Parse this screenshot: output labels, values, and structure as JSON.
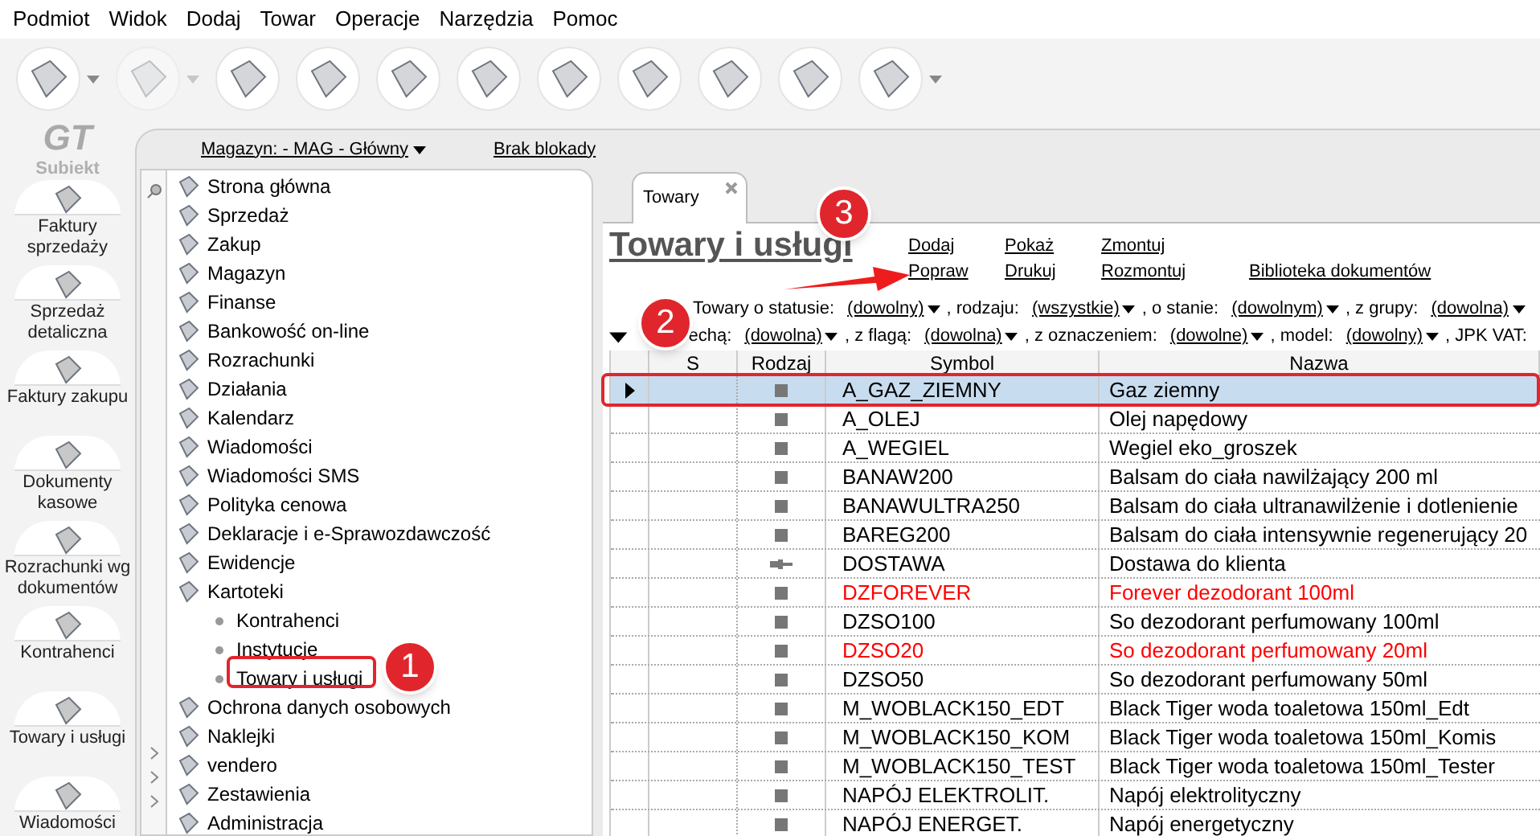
{
  "menu": [
    "Podmiot",
    "Widok",
    "Dodaj",
    "Towar",
    "Operacje",
    "Narzędzia",
    "Pomoc"
  ],
  "toolbar": [
    {
      "dropdown": true,
      "disabled": false
    },
    {
      "dropdown": true,
      "disabled": true
    },
    {
      "dropdown": false,
      "disabled": false
    },
    {
      "dropdown": false,
      "disabled": false
    },
    {
      "dropdown": false,
      "disabled": false
    },
    {
      "dropdown": false,
      "disabled": false
    },
    {
      "dropdown": false,
      "disabled": false
    },
    {
      "dropdown": false,
      "disabled": false
    },
    {
      "dropdown": false,
      "disabled": false
    },
    {
      "dropdown": false,
      "disabled": false
    },
    {
      "dropdown": true,
      "disabled": false
    }
  ],
  "logo": {
    "mark": "GT",
    "name": "Subiekt"
  },
  "rail": [
    "Faktury sprzedaży",
    "Sprzedaż detaliczna",
    "Faktury zakupu",
    "Dokumenty kasowe",
    "Rozrachunki wg dokumentów",
    "Kontrahenci",
    "Towary i usługi",
    "Wiadomości"
  ],
  "topbar": {
    "warehouse": "Magazyn: - MAG - Główny",
    "lock": "Brak blokady"
  },
  "nav": [
    {
      "label": "Strona główna"
    },
    {
      "label": "Sprzedaż"
    },
    {
      "label": "Zakup"
    },
    {
      "label": "Magazyn"
    },
    {
      "label": "Finanse"
    },
    {
      "label": "Bankowość on-line"
    },
    {
      "label": "Rozrachunki"
    },
    {
      "label": "Działania"
    },
    {
      "label": "Kalendarz"
    },
    {
      "label": "Wiadomości"
    },
    {
      "label": "Wiadomości SMS"
    },
    {
      "label": "Polityka cenowa"
    },
    {
      "label": "Deklaracje i e-Sprawozdawczość"
    },
    {
      "label": "Ewidencje"
    },
    {
      "label": "Kartoteki",
      "children": [
        {
          "label": "Kontrahenci"
        },
        {
          "label": "Instytucje"
        },
        {
          "label": "Towary i usługi"
        }
      ]
    },
    {
      "label": "Ochrona danych osobowych"
    },
    {
      "label": "Naklejki"
    },
    {
      "label": "vendero"
    },
    {
      "label": "Zestawienia"
    },
    {
      "label": "Administracja"
    }
  ],
  "tab": {
    "label": "Towary",
    "selected": true
  },
  "heading": "Towary i usługi",
  "actions": [
    [
      "Dodaj",
      "Popraw"
    ],
    [
      "Pokaż",
      "Drukuj"
    ],
    [
      "Zmontuj",
      "Rozmontuj"
    ],
    [
      "Biblioteka dokumentów"
    ]
  ],
  "filters": [
    [
      {
        "label": "Towary o statusie:",
        "value": "(dowolny)"
      },
      {
        "label": ", rodzaju:",
        "value": "(wszystkie)"
      },
      {
        "label": ", o stanie:",
        "value": "(dowolnym)"
      },
      {
        "label": ", z grupy:",
        "value": "(dowolna)"
      }
    ],
    [
      {
        "label": "echą:",
        "value": "(dowolna)"
      },
      {
        "label": ", z flagą:",
        "value": "(dowolna)"
      },
      {
        "label": ", z oznaczeniem:",
        "value": "(dowolne)"
      },
      {
        "label": ", model:",
        "value": "(dowolny)"
      },
      {
        "label": ", JPK VAT:"
      }
    ]
  ],
  "table": {
    "columns": [
      "S",
      "Rodzaj",
      "Symbol",
      "Nazwa"
    ],
    "rows": [
      {
        "kind": "goods",
        "symbol": "A_GAZ_ZIEMNY",
        "name": "Gaz ziemny",
        "selected": true,
        "color": "#000000"
      },
      {
        "kind": "goods",
        "symbol": "A_OLEJ",
        "name": "Olej napędowy",
        "selected": false,
        "color": "#000000"
      },
      {
        "kind": "goods",
        "symbol": "A_WEGIEL",
        "name": "Wegiel eko_groszek",
        "selected": false,
        "color": "#000000"
      },
      {
        "kind": "goods",
        "symbol": "BANAW200",
        "name": "Balsam do ciała nawilżający 200 ml",
        "selected": false,
        "color": "#000000"
      },
      {
        "kind": "goods",
        "symbol": "BANAWULTRA250",
        "name": "Balsam do ciała ultranawilżenie i dotlenienie",
        "selected": false,
        "color": "#000000"
      },
      {
        "kind": "goods",
        "symbol": "BAREG200",
        "name": "Balsam do ciała intensywnie regenerujący 20",
        "selected": false,
        "color": "#000000"
      },
      {
        "kind": "service",
        "symbol": "DOSTAWA",
        "name": "Dostawa do klienta",
        "selected": false,
        "color": "#000000"
      },
      {
        "kind": "goods",
        "symbol": "DZFOREVER",
        "name": "Forever dezodorant 100ml",
        "selected": false,
        "color": "#ff0000"
      },
      {
        "kind": "goods",
        "symbol": "DZSO100",
        "name": "So dezodorant perfumowany 100ml",
        "selected": false,
        "color": "#000000"
      },
      {
        "kind": "goods",
        "symbol": "DZSO20",
        "name": "So dezodorant perfumowany 20ml",
        "selected": false,
        "color": "#ff0000"
      },
      {
        "kind": "goods",
        "symbol": "DZSO50",
        "name": "So dezodorant perfumowany 50ml",
        "selected": false,
        "color": "#000000"
      },
      {
        "kind": "goods",
        "symbol": "M_WOBLACK150_EDT",
        "name": "Black Tiger woda toaletowa 150ml_Edt",
        "selected": false,
        "color": "#000000"
      },
      {
        "kind": "goods",
        "symbol": "M_WOBLACK150_KOM",
        "name": "Black Tiger woda toaletowa 150ml_Komis",
        "selected": false,
        "color": "#000000"
      },
      {
        "kind": "goods",
        "symbol": "M_WOBLACK150_TEST",
        "name": "Black Tiger woda toaletowa 150ml_Tester",
        "selected": false,
        "color": "#000000"
      },
      {
        "kind": "goods",
        "symbol": "NAPÓJ ELEKTROLIT.",
        "name": "Napój elektrolityczny",
        "selected": false,
        "color": "#000000"
      },
      {
        "kind": "goods",
        "symbol": "NAPÓJ ENERGET.",
        "name": "Napój energetyczny",
        "selected": false,
        "color": "#000000"
      }
    ]
  },
  "annotations": [
    "1",
    "2",
    "3"
  ]
}
